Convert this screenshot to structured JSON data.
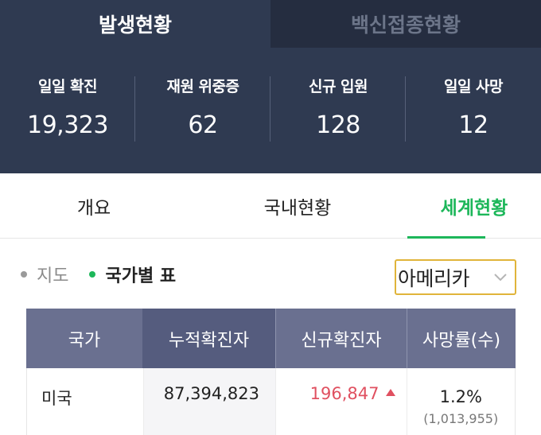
{
  "top_tabs": {
    "active": "발생현황",
    "inactive": "백신접종현황"
  },
  "stats": [
    {
      "label": "일일 확진",
      "value": "19,323"
    },
    {
      "label": "재원 위중증",
      "value": "62"
    },
    {
      "label": "신규 입원",
      "value": "128"
    },
    {
      "label": "일일 사망",
      "value": "12"
    }
  ],
  "section_tabs": [
    "개요",
    "국내현황",
    "세계현황"
  ],
  "section_tabs_active_index": 2,
  "view_toggle": {
    "map_label": "지도",
    "table_label": "국가별 표",
    "selected": "table"
  },
  "region_select": {
    "value": "아메리카"
  },
  "table": {
    "headers": [
      "국가",
      "누적확진자",
      "신규확진자",
      "사망률(수)"
    ],
    "rows": [
      {
        "country": "미국",
        "cumulative": "87,394,823",
        "new": "196,847",
        "new_trend": "up",
        "death_rate": "1.2%",
        "deaths": "(1,013,955)"
      }
    ]
  },
  "colors": {
    "header_bg": "#2f3a51",
    "accent_green": "#1db75a",
    "increase_red": "#e05060",
    "select_border": "#e0b43a"
  }
}
